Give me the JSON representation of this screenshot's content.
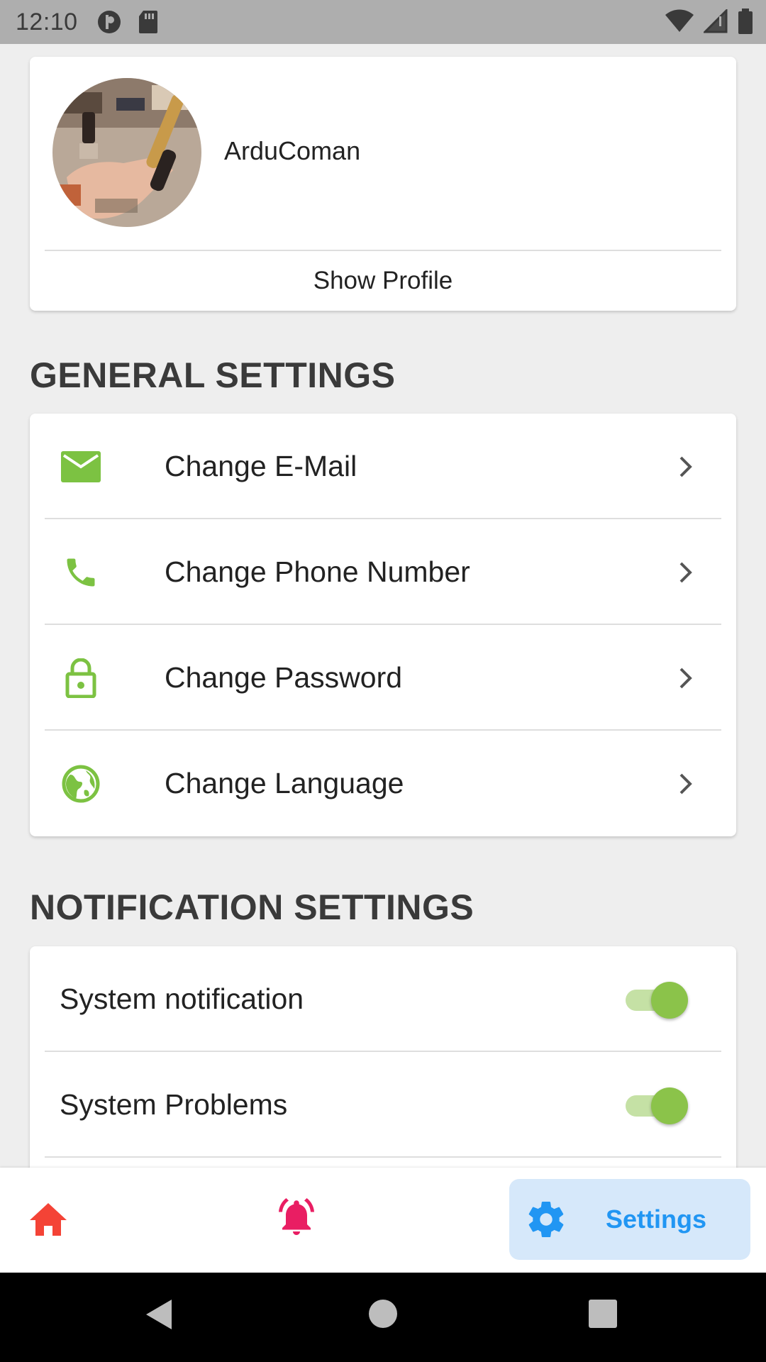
{
  "status_bar": {
    "time": "12:10"
  },
  "profile": {
    "name": "ArduComan",
    "show_profile_label": "Show Profile"
  },
  "general_settings": {
    "title": "GENERAL SETTINGS",
    "items": [
      {
        "label": "Change E-Mail",
        "icon": "email-icon"
      },
      {
        "label": "Change Phone Number",
        "icon": "phone-icon"
      },
      {
        "label": "Change Password",
        "icon": "lock-icon"
      },
      {
        "label": "Change Language",
        "icon": "globe-icon"
      }
    ]
  },
  "notification_settings": {
    "title": "NOTIFICATION SETTINGS",
    "items": [
      {
        "label": "System notification",
        "enabled": true
      },
      {
        "label": "System Problems",
        "enabled": true
      }
    ]
  },
  "bottom_nav": {
    "items": [
      {
        "icon": "home-icon",
        "label": ""
      },
      {
        "icon": "bell-icon",
        "label": ""
      },
      {
        "icon": "gear-icon",
        "label": "Settings",
        "active": true
      }
    ]
  },
  "colors": {
    "accent_green": "#8bc34a",
    "icon_green": "#7cc242",
    "home_red": "#f44336",
    "bell_pink": "#e91e63",
    "settings_blue": "#2196f3",
    "settings_bg": "#d6e8fa"
  }
}
